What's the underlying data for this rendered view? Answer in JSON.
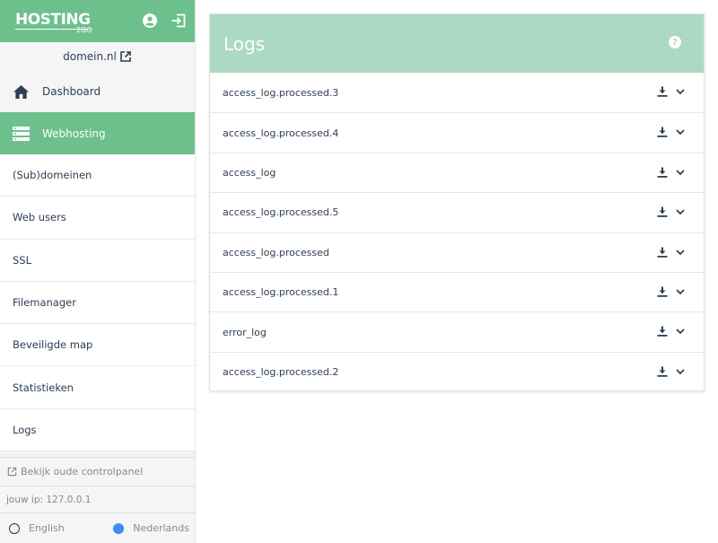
{
  "brand": {
    "name": "HOSTING",
    "sub": "2GO"
  },
  "sidebar": {
    "domain": "domein.nl",
    "dashboard_label": "Dashboard",
    "webhosting_label": "Webhosting",
    "items": [
      {
        "label": "(Sub)domeinen"
      },
      {
        "label": "Web users"
      },
      {
        "label": "SSL"
      },
      {
        "label": "Filemanager"
      },
      {
        "label": "Beveiligde map"
      },
      {
        "label": "Statistieken"
      },
      {
        "label": "Logs"
      }
    ],
    "old_panel_label": "Bekijk oude controlpanel",
    "ip_label": "jouw ip: 127.0.0.1",
    "languages": [
      {
        "label": "English",
        "selected": false
      },
      {
        "label": "Nederlands",
        "selected": true
      }
    ]
  },
  "main": {
    "title": "Logs",
    "help_label": "?",
    "logs": [
      {
        "name": "access_log.processed.3"
      },
      {
        "name": "access_log.processed.4"
      },
      {
        "name": "access_log"
      },
      {
        "name": "access_log.processed.5"
      },
      {
        "name": "access_log.processed"
      },
      {
        "name": "access_log.processed.1"
      },
      {
        "name": "error_log"
      },
      {
        "name": "access_log.processed.2"
      }
    ]
  },
  "colors": {
    "brand_green": "#6cc08c",
    "panel_header": "#abd9c3",
    "text_dark": "#2c3e55",
    "radio_on": "#3f8df0"
  }
}
